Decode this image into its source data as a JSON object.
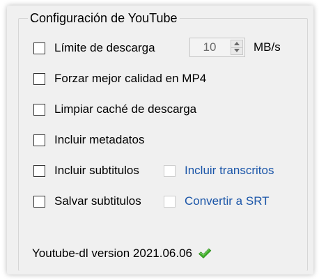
{
  "group": {
    "title": "Configuración de YouTube"
  },
  "options": {
    "limit_download": {
      "label": "Límite de descarga",
      "checked": false,
      "value": "10",
      "unit": "MB/s"
    },
    "force_mp4": {
      "label": "Forzar mejor calidad en MP4",
      "checked": false
    },
    "clear_cache": {
      "label": "Limpiar caché de descarga",
      "checked": false
    },
    "include_metadata": {
      "label": "Incluir metadatos",
      "checked": false
    },
    "include_subtitles": {
      "label": "Incluir subtitulos",
      "checked": false
    },
    "include_transcripts": {
      "label": "Incluir transcritos",
      "checked": false,
      "enabled": false
    },
    "save_subtitles": {
      "label": "Salvar subtitulos",
      "checked": false
    },
    "convert_srt": {
      "label": "Convertir a SRT",
      "checked": false,
      "enabled": false
    }
  },
  "status": {
    "version_text": "Youtube-dl version 2021.06.06",
    "status_icon": "check-icon",
    "status_color": "#3fae2a"
  },
  "colors": {
    "panel_background": "#f0f0f0",
    "link_blue": "#1a55a8"
  }
}
